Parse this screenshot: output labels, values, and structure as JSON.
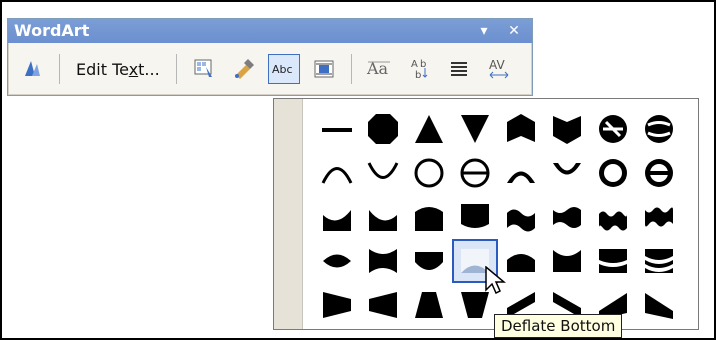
{
  "window": {
    "title": "WordArt"
  },
  "toolbar": {
    "edit_text_label": "Edit Text...",
    "edit_text_accessor": "x"
  },
  "dropdown": {
    "shapes": [
      "plain-text-shape",
      "stop-shape",
      "triangle-up-shape",
      "triangle-down-shape",
      "chevron-up-shape",
      "chevron-down-shape",
      "ring-inside-shape",
      "ring-outside-shape",
      "arch-up-curve-shape",
      "arch-down-curve-shape",
      "circle-curve-shape",
      "button-curve-shape",
      "arch-up-pour-shape",
      "arch-down-pour-shape",
      "circle-pour-shape",
      "button-pour-shape",
      "curve-up-shape",
      "curve-down-shape",
      "can-up-shape",
      "can-down-shape",
      "wave1-shape",
      "wave2-shape",
      "double-wave1-shape",
      "double-wave2-shape",
      "inflate-shape",
      "deflate-shape",
      "inflate-bottom-shape",
      "deflate-bottom-shape",
      "inflate-top-shape",
      "deflate-top-shape",
      "deflate-inflate-shape",
      "deflate-inflate-deflate-shape",
      "fade-right-shape",
      "fade-left-shape",
      "fade-up-shape",
      "fade-down-shape",
      "slant-up-shape",
      "slant-down-shape",
      "cascade-up-shape",
      "cascade-down-shape"
    ],
    "selected_index": 27
  },
  "tooltip": {
    "text": "Deflate Bottom"
  }
}
